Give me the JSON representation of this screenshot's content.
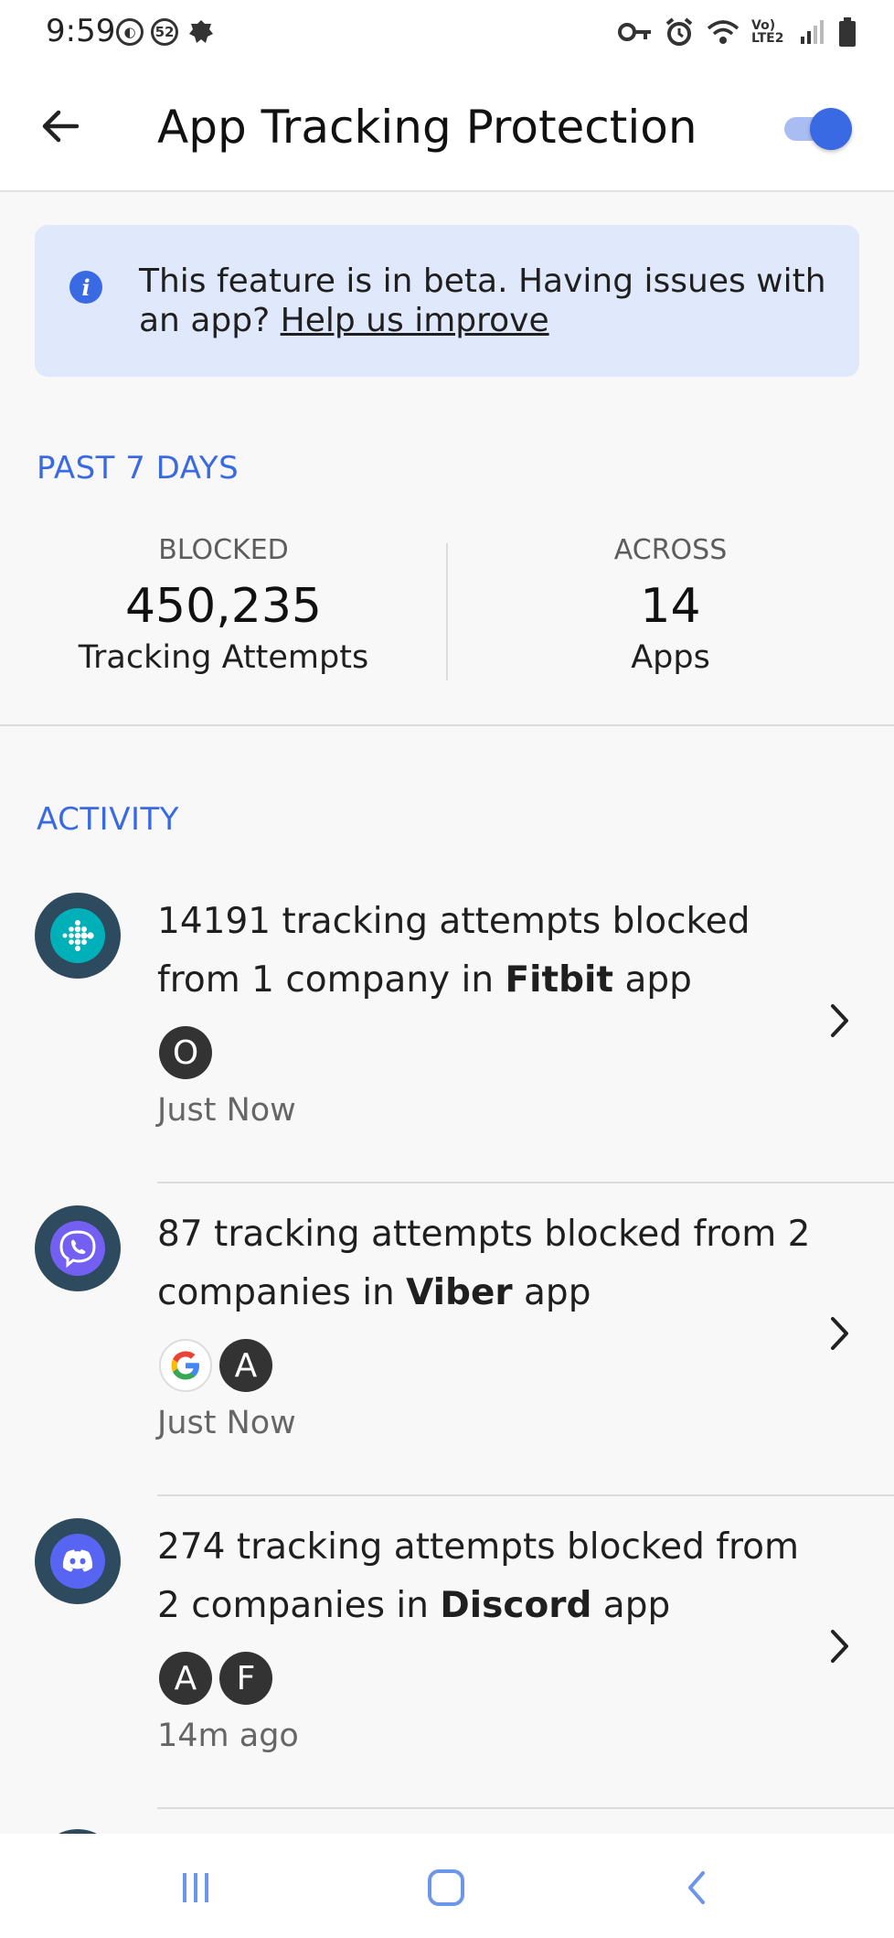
{
  "status_bar": {
    "time": "9:59",
    "badge_count": "52",
    "network": "Vo) LTE2"
  },
  "app_bar": {
    "title": "App Tracking Protection",
    "toggle_on": true,
    "accent_color": "#3a6ae3"
  },
  "banner": {
    "text": "This feature is in beta. Having issues with an app?",
    "link_text": "Help us improve"
  },
  "stats": {
    "section_label": "PAST 7 DAYS",
    "blocked_label": "BLOCKED",
    "blocked_value": "450,235",
    "blocked_sub": "Tracking Attempts",
    "across_label": "ACROSS",
    "across_value": "14",
    "across_sub": "Apps"
  },
  "activity": {
    "section_label": "ACTIVITY",
    "items": [
      {
        "text_before": "14191 tracking attempts blocked from 1 company in ",
        "app_name": "Fitbit",
        "text_after": " app",
        "companies": [
          "O"
        ],
        "time": "Just Now",
        "icon": "fitbit-icon"
      },
      {
        "text_before": "87 tracking attempts blocked from 2 companies in ",
        "app_name": "Viber",
        "text_after": " app",
        "companies": [
          "G",
          "A"
        ],
        "time": "Just Now",
        "icon": "viber-icon"
      },
      {
        "text_before": "274 tracking attempts blocked from 2 companies in ",
        "app_name": "Discord",
        "text_after": " app",
        "companies": [
          "A",
          "F"
        ],
        "time": "14m ago",
        "icon": "discord-icon"
      }
    ]
  }
}
